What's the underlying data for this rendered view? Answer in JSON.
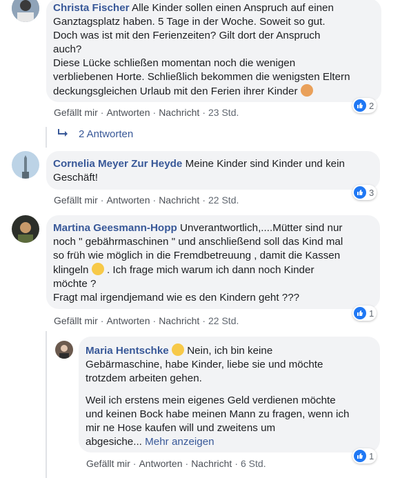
{
  "comments": [
    {
      "author": "Christa Fischer",
      "text_1": "Alle Kinder sollen einen Anspruch auf einen",
      "text_2": "Ganztagsplatz haben. 5 Tage in der Woche. Soweit so gut.",
      "text_3": "Doch was ist mit den Ferienzeiten? Gilt dort der Anspruch",
      "text_4": "auch?",
      "text_5": "Diese Lücke schließen momentan noch die wenigen",
      "text_6": "verbliebenen Horte. Schließlich bekommen die wenigsten Eltern",
      "text_7": "deckungsgleichen Urlaub mit den Ferien ihrer Kinder",
      "like": "Gefällt mir",
      "reply": "Antworten",
      "message": "Nachricht",
      "time": "23 Std.",
      "reactions": "2"
    },
    {
      "author": "Cornelia Meyer Zur Heyde",
      "text_1": "Meine Kinder sind Kinder und kein",
      "text_2": "Geschäft!",
      "like": "Gefällt mir",
      "reply": "Antworten",
      "message": "Nachricht",
      "time": "22 Std.",
      "reactions": "3"
    },
    {
      "author": "Martina Geesmann-Hopp",
      "text_1": "Unverantwortlich,....Mütter sind nur",
      "text_2": "noch \" gebährmaschinen \" und anschließend soll das Kind mal",
      "text_3": "so früh wie möglich in die Fremdbetreuung , damit die Kassen",
      "text_4a": "klingeln",
      "text_4b": ". Ich frage mich warum ich dann noch Kinder",
      "text_5": "möchte ?",
      "text_6": "Fragt mal irgendjemand wie es den Kindern geht ???",
      "like": "Gefällt mir",
      "reply": "Antworten",
      "message": "Nachricht",
      "time": "22 Std.",
      "reactions": "1"
    },
    {
      "author": "Maria Hentschke",
      "text_1": "Nein, ich bin keine",
      "text_2": "Gebärmaschine, habe Kinder, liebe sie und möchte",
      "text_3": "trotzdem arbeiten gehen.",
      "text_4": "Weil ich erstens mein eigenes Geld verdienen möchte",
      "text_5": "und keinen Bock habe meinen Mann zu fragen, wenn ich",
      "text_6": "mir ne Hose kaufen will und zweitens um",
      "text_7": "abgesiche...",
      "more": "Mehr anzeigen",
      "like": "Gefällt mir",
      "reply": "Antworten",
      "message": "Nachricht",
      "time": "6 Std.",
      "reactions": "1"
    }
  ],
  "replies_link": "2 Antworten",
  "colors": {
    "link": "#385898",
    "bubble": "#f2f3f5",
    "like_blue": "#2078f4"
  }
}
